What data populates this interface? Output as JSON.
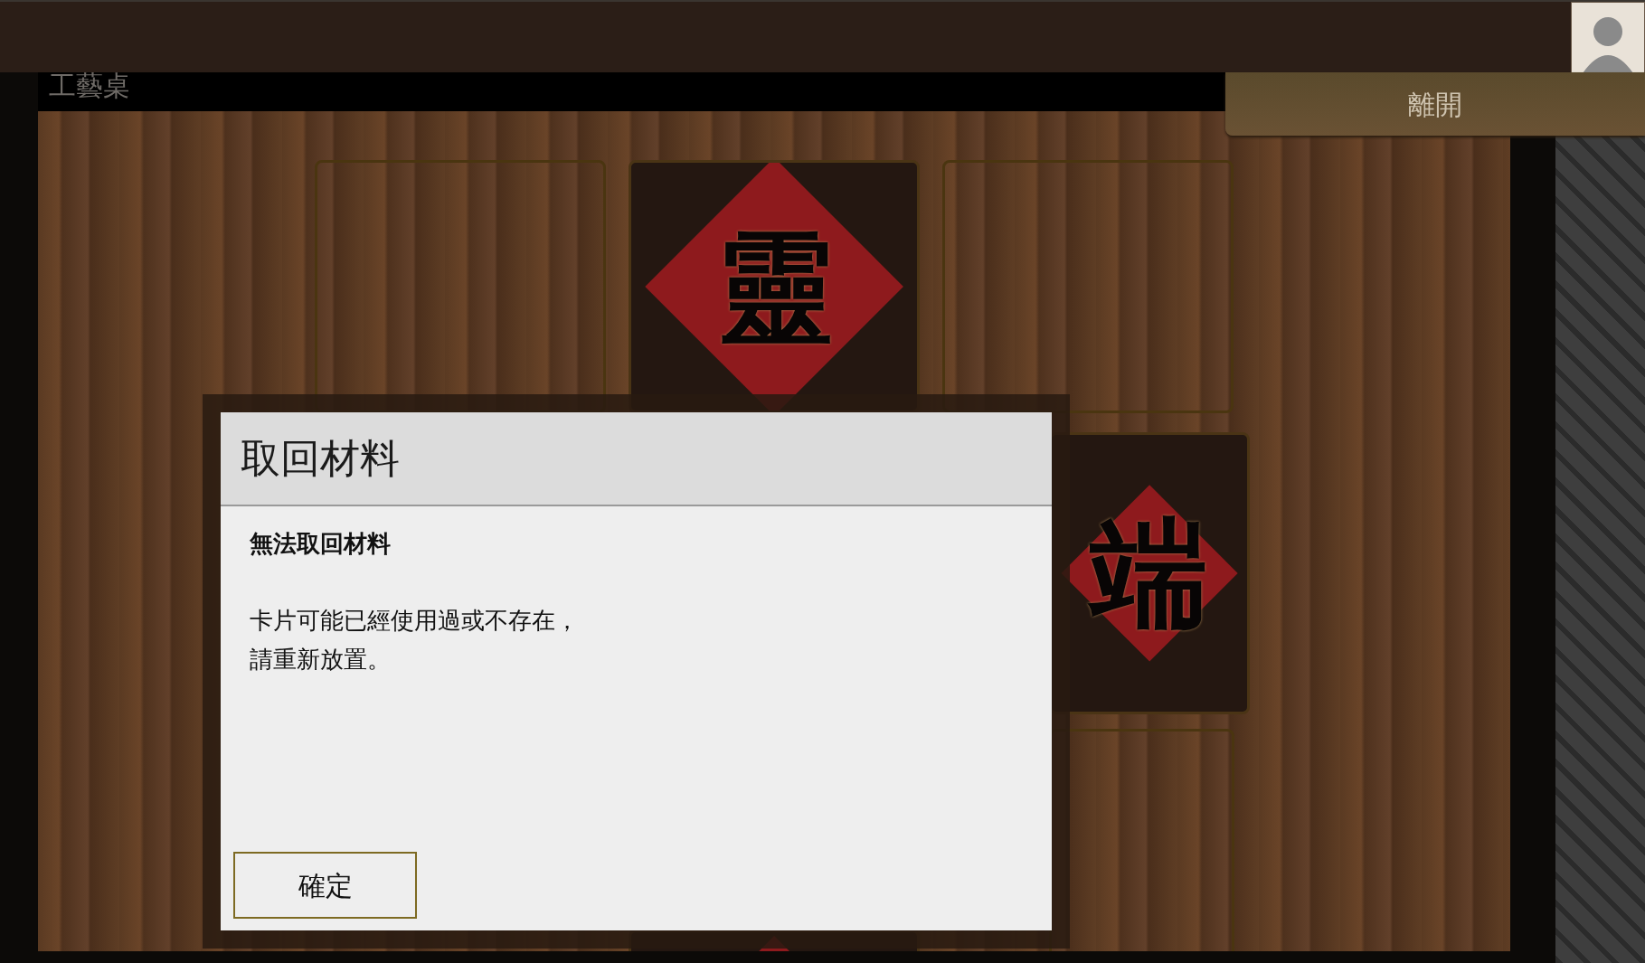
{
  "header": {
    "title": "工藝桌",
    "leave_button": "離開"
  },
  "board": {
    "slots": [
      {
        "kind": "empty"
      },
      {
        "kind": "card",
        "glyph": "靈"
      },
      {
        "kind": "empty"
      },
      {
        "kind": "card",
        "glyph": "端"
      },
      {
        "kind": "empty"
      },
      {
        "kind": "card"
      }
    ]
  },
  "dialog": {
    "title": "取回材料",
    "heading": "無法取回材料",
    "message_lines": [
      "卡片可能已經使用過或不存在，",
      "請重新放置。"
    ],
    "button": "確定"
  }
}
